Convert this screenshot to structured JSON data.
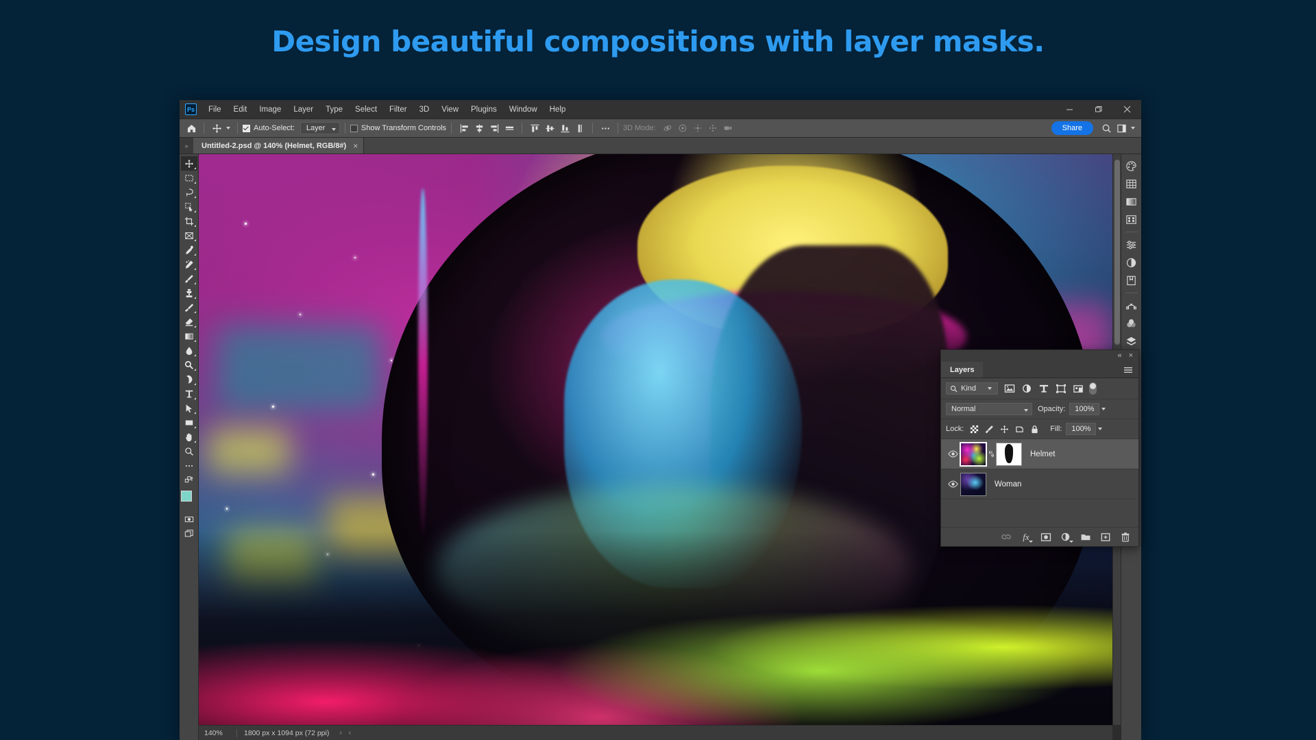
{
  "headline": "Design beautiful compositions with layer masks.",
  "colors": {
    "page_background": "#042238",
    "headline": "#2e9bf0",
    "accent_share": "#1473e6",
    "foreground_swatch": "#7fd4c8",
    "background_swatch": "#ffffff"
  },
  "app": {
    "logo_text": "Ps",
    "menus": [
      "File",
      "Edit",
      "Image",
      "Layer",
      "Type",
      "Select",
      "Filter",
      "3D",
      "View",
      "Plugins",
      "Window",
      "Help"
    ],
    "window_controls": {
      "minimize": "minimize-icon",
      "restore": "restore-icon",
      "close": "close-icon"
    }
  },
  "options_bar": {
    "home_icon": "home-icon",
    "tool_icon": "move-tool-icon",
    "auto_select_label": "Auto-Select:",
    "auto_select_checked": true,
    "auto_select_value": "Layer",
    "show_transform_label": "Show Transform Controls",
    "show_transform_checked": false,
    "align_icons": [
      "align-left-edges-icon",
      "align-horizontal-centers-icon",
      "align-right-edges-icon",
      "distribute-horizontal-icon"
    ],
    "align_icons_2": [
      "align-top-edges-icon",
      "align-vertical-centers-icon",
      "align-bottom-edges-icon",
      "distribute-vertical-icon"
    ],
    "more_icon": "more-options-icon",
    "mode_3d_label": "3D Mode:",
    "mode_3d_icons": [
      "orbit-3d-icon",
      "roll-3d-icon",
      "pan-3d-icon",
      "slide-3d-icon",
      "camera-3d-icon"
    ],
    "share_label": "Share",
    "search_icon": "search-icon",
    "workspace_icon": "workspace-icon"
  },
  "document": {
    "tab_title": "Untitled-2.psd @ 140% (Helmet, RGB/8#)",
    "close_icon": "close-icon"
  },
  "toolbar": {
    "tools": [
      {
        "name": "move-tool",
        "icon": "move-icon",
        "active": true
      },
      {
        "name": "rectangular-marquee-tool",
        "icon": "marquee-icon",
        "active": false
      },
      {
        "name": "lasso-tool",
        "icon": "lasso-icon",
        "active": false
      },
      {
        "name": "object-selection-tool",
        "icon": "quick-select-icon",
        "active": false
      },
      {
        "name": "crop-tool",
        "icon": "crop-icon",
        "active": false
      },
      {
        "name": "frame-tool",
        "icon": "frame-icon",
        "active": false
      },
      {
        "name": "eyedropper-tool",
        "icon": "eyedropper-icon",
        "active": false
      },
      {
        "name": "spot-healing-brush-tool",
        "icon": "healing-brush-icon",
        "active": false
      },
      {
        "name": "brush-tool",
        "icon": "brush-icon",
        "active": false
      },
      {
        "name": "clone-stamp-tool",
        "icon": "clone-stamp-icon",
        "active": false
      },
      {
        "name": "history-brush-tool",
        "icon": "history-brush-icon",
        "active": false
      },
      {
        "name": "eraser-tool",
        "icon": "eraser-icon",
        "active": false
      },
      {
        "name": "gradient-tool",
        "icon": "gradient-icon",
        "active": false
      },
      {
        "name": "blur-tool",
        "icon": "blur-drop-icon",
        "active": false
      },
      {
        "name": "dodge-tool",
        "icon": "dodge-icon",
        "active": false
      },
      {
        "name": "pen-tool",
        "icon": "pen-icon",
        "active": false
      },
      {
        "name": "type-tool",
        "icon": "type-icon",
        "active": false
      },
      {
        "name": "path-selection-tool",
        "icon": "path-arrow-icon",
        "active": false
      },
      {
        "name": "rectangle-tool",
        "icon": "rectangle-icon",
        "active": false
      },
      {
        "name": "hand-tool",
        "icon": "hand-icon",
        "active": false
      },
      {
        "name": "zoom-tool",
        "icon": "zoom-icon",
        "active": false
      },
      {
        "name": "edit-toolbar",
        "icon": "more-dots-icon",
        "active": false
      }
    ],
    "quick-mask-icon": "quick-mask-icon",
    "screen-mode-icon": "screen-mode-icon"
  },
  "dock": {
    "icons": [
      "color-palette-icon",
      "swatches-icon",
      "gradients-icon",
      "patterns-icon",
      "adjustments-icon",
      "adjustment-layer-icon",
      "libraries-icon",
      "paths-icon",
      "channels-icon",
      "layers-icon"
    ]
  },
  "status_bar": {
    "zoom": "140%",
    "doc_size": "1800 px x 1094 px (72 ppi)",
    "arrow_right": "›",
    "arrow_left": "‹"
  },
  "layers_panel": {
    "collapse_icon": "collapse-panel-icon",
    "close_icon": "close-icon",
    "tab_label": "Layers",
    "menu_icon": "panel-menu-icon",
    "filter": {
      "search_icon": "search-icon",
      "kind_label": "Kind",
      "type_icons": [
        "filter-pixel-icon",
        "filter-adjustment-icon",
        "filter-type-icon",
        "filter-shape-icon",
        "filter-smart-object-icon"
      ],
      "toggle_icon": "filter-toggle-switch"
    },
    "blend_mode": "Normal",
    "opacity_label": "Opacity:",
    "opacity_value": "100%",
    "lock_label": "Lock:",
    "lock_icons": [
      "lock-transparent-pixels-icon",
      "lock-image-pixels-icon",
      "lock-position-icon",
      "lock-artboard-icon",
      "lock-all-icon"
    ],
    "fill_label": "Fill:",
    "fill_value": "100%",
    "layers": [
      {
        "name": "Helmet",
        "visible": true,
        "selected": true,
        "has_mask": true,
        "linked": true,
        "thumbnail": "colorful-helmet-thumbnail",
        "mask_thumbnail": "layer-mask-thumbnail"
      },
      {
        "name": "Woman",
        "visible": true,
        "selected": false,
        "has_mask": false,
        "linked": false,
        "thumbnail": "woman-portrait-thumbnail"
      }
    ],
    "footer_icons": [
      "link-layers-icon",
      "layer-styles-fx-icon",
      "add-layer-mask-icon",
      "new-adjustment-layer-icon",
      "new-group-icon",
      "new-layer-icon",
      "delete-layer-icon"
    ]
  }
}
